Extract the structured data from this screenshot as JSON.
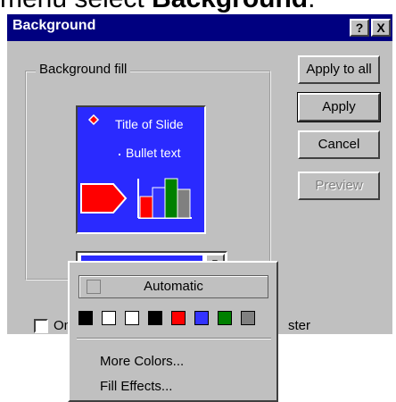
{
  "caption": {
    "prefix": "menu select ",
    "bold": "Background",
    "suffix": "."
  },
  "dialog": {
    "title": "Background",
    "help_btn": "?",
    "close_btn": "X",
    "group_label": "Background fill",
    "preview": {
      "title": "Title of Slide",
      "bullet": "Bullet text"
    },
    "buttons": {
      "apply_all": "Apply to all",
      "apply": "Apply",
      "cancel": "Cancel",
      "preview": "Preview"
    },
    "checkbox": {
      "label_start": "Om",
      "label_end": "ster",
      "checked": false
    }
  },
  "fill_dropdown": {
    "selected_color": "#2a2aff",
    "automatic_label": "Automatic",
    "swatches": [
      "#000000",
      "#ffffff",
      "#ffffff",
      "#000000",
      "#ff0000",
      "#3333ff",
      "#008000",
      "#808080"
    ],
    "more_colors": "More Colors...",
    "fill_effects": "Fill Effects..."
  }
}
